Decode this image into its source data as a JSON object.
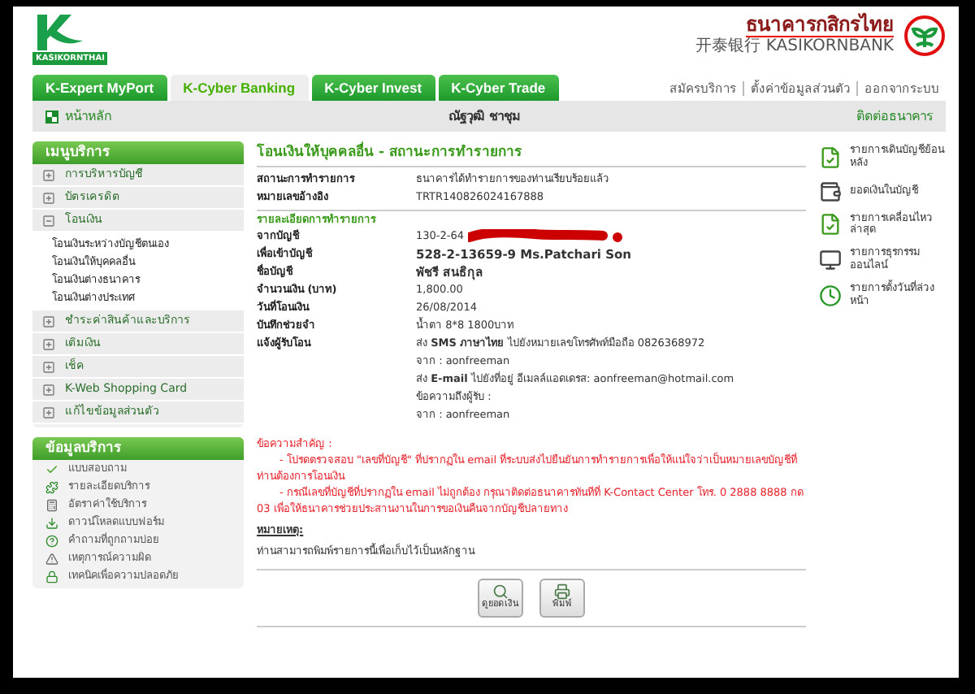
{
  "header": {
    "logo_text": "KASIKORNTHAI",
    "bank_name": "ธนาคารกสิกรไทย",
    "bank_name_chinese": "开泰银行",
    "bank_name_english": "KASIKORNBANK"
  },
  "tabs": [
    {
      "label": "K-Expert MyPort",
      "selected": false
    },
    {
      "label": "K-Cyber Banking",
      "selected": true
    },
    {
      "label": "K-Cyber Invest",
      "selected": false
    },
    {
      "label": "K-Cyber Trade",
      "selected": false
    }
  ],
  "top_links": [
    "สมัครบริการ",
    "ตั้งค่าข้อมูลส่วนตัว",
    "ออกจากระบบ"
  ],
  "nav_bar": {
    "home": "หน้าหลัก",
    "user_name": "ณัฐวุฒิ ชาชุม",
    "contact": "ติดต่อธนาคาร"
  },
  "menu": {
    "title": "เมนูบริการ",
    "items": [
      {
        "label": "การบริหารบัญชี",
        "expanded": false
      },
      {
        "label": "บัตรเครดิต",
        "expanded": false
      },
      {
        "label": "โอนเงิน",
        "expanded": true,
        "children": [
          {
            "label": "โอนเงินระหว่างบัญชีตนเอง"
          },
          {
            "label": "โอนเงินให้บุคคลอื่น"
          },
          {
            "label": "โอนเงินต่างธนาคาร"
          },
          {
            "label": "โอนเงินต่างประเทศ"
          }
        ]
      },
      {
        "label": "ชำระค่าสินค้าและบริการ",
        "expanded": false
      },
      {
        "label": "เติมเงิน",
        "expanded": false
      },
      {
        "label": "เช็ค",
        "expanded": false
      },
      {
        "label": "K-Web Shopping Card",
        "expanded": false
      },
      {
        "label": "แก้ไขข้อมูลส่วนตัว",
        "expanded": false
      }
    ]
  },
  "info": {
    "title": "ข้อมูลบริการ",
    "items": [
      {
        "label": "แบบสอบถาม",
        "kind": "check"
      },
      {
        "label": "รายละเอียดบริการ",
        "kind": "puzzle"
      },
      {
        "label": "อัตราค่าใช้บริการ",
        "kind": "calculator"
      },
      {
        "label": "ดาวน์โหลดแบบฟอร์ม",
        "kind": "download"
      },
      {
        "label": "คำถามที่ถูกถามบ่อย",
        "kind": "question"
      },
      {
        "label": "เหตุการณ์ความผิด",
        "kind": "warning"
      },
      {
        "label": "เทคนิคเพื่อความปลอดภัย",
        "kind": "lock"
      }
    ]
  },
  "main": {
    "title": "โอนเงินให้บุคคลอื่น - สถานะการทำรายการ",
    "status_rows": [
      {
        "label": "สถานะการทำรายการ",
        "value": "ธนาคารได้ทำรายการของท่านเรียบร้อยแล้ว"
      },
      {
        "label": "หมายเลขอ้างอิง",
        "value": "TRTR140826024167888"
      }
    ],
    "details_title": "รายละเอียดการทำรายการ",
    "details": [
      {
        "label": "จากบัญชี",
        "value": "130-2-64",
        "emphasis": false,
        "redacted": true
      },
      {
        "label": "เพื่อเข้าบัญชี",
        "value": "528-2-13659-9 Ms.Patchari Son",
        "emphasis": true,
        "redacted": false
      },
      {
        "label": "ชื่อบัญชี",
        "value": "พัชรี สนธิกุล",
        "emphasis": true,
        "redacted": false
      },
      {
        "label": "จำนวนเงิน (บาท)",
        "value": "1,800.00",
        "emphasis": false,
        "redacted": false
      },
      {
        "label": "วันที่โอนเงิน",
        "value": "26/08/2014",
        "emphasis": false,
        "redacted": false
      },
      {
        "label": "บันทึกช่วยจำ",
        "value": "น้ำตา 8*8 1800บาท",
        "emphasis": false,
        "redacted": false
      }
    ],
    "notify": {
      "label": "แจ้งผู้รับโอน",
      "lines": [
        "ส่ง **SMS ภาษาไทย** ไปยังหมายเลขโทรศัพท์มือถือ 0826368972",
        "จาก : aonfreeman",
        "ส่ง **E-mail** ไปยังที่อยู่ อีเมลล์แอดเดรส: aonfreeman@hotmail.com",
        "ข้อความถึงผู้รับ :",
        "จาก : aonfreeman"
      ]
    },
    "notice": {
      "title": "ข้อความสำคัญ :",
      "lines": [
        "- โปรดตรวจสอบ \"เลขที่บัญชี\" ที่ปรากฏใน email ที่ระบบส่งไปยืนยันการทำรายการเพื่อให้แน่ใจว่าเป็นหมายเลขบัญชีที่ท่านต้องการโอนเงิน",
        "- กรณีเลขที่บัญชีที่ปรากฏใน email ไม่ถูกต้อง กรุณาติดต่อธนาคารทันทีที่ K-Contact Center โทร. 0 2888 8888 กด 03 เพื่อให้ธนาคารช่วยประสานงานในการขอเงินคืนจากบัญชีปลายทาง"
      ]
    },
    "remark": {
      "title": "หมายเหตุ:",
      "text": "ท่านสามารถพิมพ์รายการนี้เพื่อเก็บไว้เป็นหลักฐาน"
    },
    "buttons": [
      {
        "label": "ดูยอดเงิน",
        "kind": "view"
      },
      {
        "label": "พิมพ์",
        "kind": "print"
      }
    ]
  },
  "quick_links": [
    {
      "label": "รายการเดินบัญชีย้อนหลัง",
      "kind": "statement"
    },
    {
      "label": "ยอดเงินในบัญชี",
      "kind": "balance"
    },
    {
      "label": "รายการเคลื่อนไหวล่าสุด",
      "kind": "recent"
    },
    {
      "label": "รายการธุรกรรมออนไลน์",
      "kind": "online"
    },
    {
      "label": "รายการตั้งวันที่ล่วงหน้า",
      "kind": "scheduled"
    }
  ]
}
